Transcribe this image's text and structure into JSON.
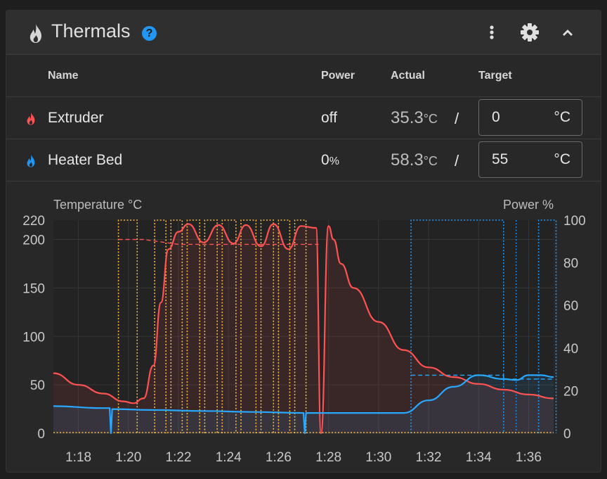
{
  "header": {
    "title": "Thermals",
    "help_icon": "?",
    "icons": [
      "flame-icon",
      "help-icon",
      "more-vert-icon",
      "gear-icon",
      "chevron-up-icon"
    ]
  },
  "table": {
    "columns": [
      "Name",
      "Power",
      "Actual",
      "Target"
    ],
    "rows": [
      {
        "name": "Extruder",
        "icon_color": "#ff5252",
        "power": "off",
        "power_unit": "",
        "actual": "35.3",
        "actual_unit": "°C",
        "separator": "/",
        "target": "0",
        "target_unit": "°C"
      },
      {
        "name": "Heater Bed",
        "icon_color": "#2196f3",
        "power": "0",
        "power_unit": "%",
        "actual": "58.3",
        "actual_unit": "°C",
        "separator": "/",
        "target": "55",
        "target_unit": "°C"
      }
    ]
  },
  "chart_data": {
    "type": "line",
    "ylabel": "Temperature °C",
    "y2label": "Power %",
    "ylim": [
      0,
      220
    ],
    "y2lim": [
      0,
      100
    ],
    "yticks": [
      0,
      50,
      100,
      150,
      200,
      220
    ],
    "y2ticks": [
      0,
      20,
      40,
      60,
      80,
      100
    ],
    "xticks": [
      "1:18",
      "1:20",
      "1:22",
      "1:24",
      "1:26",
      "1:28",
      "1:30",
      "1:32",
      "1:34",
      "1:36"
    ],
    "xlim": [
      1062,
      1082
    ],
    "colors": {
      "extruder": "#ff5252",
      "bed": "#29a8ff",
      "extruder_power": "#f5b642",
      "bed_power": "#2196f3"
    },
    "series": [
      {
        "name": "Extruder",
        "kind": "temperature",
        "x": [
          1062,
          1063,
          1064,
          1064.8,
          1065.2,
          1065.6,
          1066,
          1066.3,
          1066.6,
          1067,
          1067.4,
          1068,
          1068.6,
          1069.2,
          1069.7,
          1070.3,
          1070.8,
          1071.4,
          1071.9,
          1072.5,
          1072.7,
          1073,
          1073.2,
          1073.5,
          1074,
          1075,
          1076,
          1077,
          1078,
          1079,
          1080,
          1081,
          1082
        ],
        "y": [
          62,
          50,
          41,
          33,
          31,
          36,
          70,
          135,
          190,
          208,
          216,
          197,
          215,
          196,
          215,
          193,
          216,
          190,
          214,
          212,
          0,
          214,
          200,
          175,
          150,
          115,
          86,
          68,
          58,
          51,
          45,
          40,
          36
        ]
      },
      {
        "name": "Heater Bed",
        "kind": "temperature",
        "x": [
          1062,
          1064,
          1064.25,
          1064.3,
          1064.35,
          1066,
          1068,
          1070,
          1072,
          1072.05,
          1072.1,
          1074,
          1076,
          1077,
          1078,
          1079,
          1080,
          1080.5,
          1081,
          1081.5,
          1082
        ],
        "y": [
          28,
          26,
          26,
          0,
          25,
          24,
          23,
          22,
          21,
          0,
          21,
          21,
          21,
          34,
          48,
          60,
          56,
          55,
          60,
          60,
          58
        ]
      },
      {
        "name": "Extruder",
        "kind": "target",
        "x": [
          1064.6,
          1065.6,
          1067,
          1068.5,
          1070,
          1071.5,
          1072.6
        ],
        "y": [
          200,
          200,
          195,
          195,
          195,
          195,
          195
        ]
      },
      {
        "name": "Heater Bed",
        "kind": "target",
        "x": [
          1076.3,
          1080,
          1080,
          1082
        ],
        "y": [
          60,
          60,
          56,
          56
        ]
      }
    ]
  }
}
